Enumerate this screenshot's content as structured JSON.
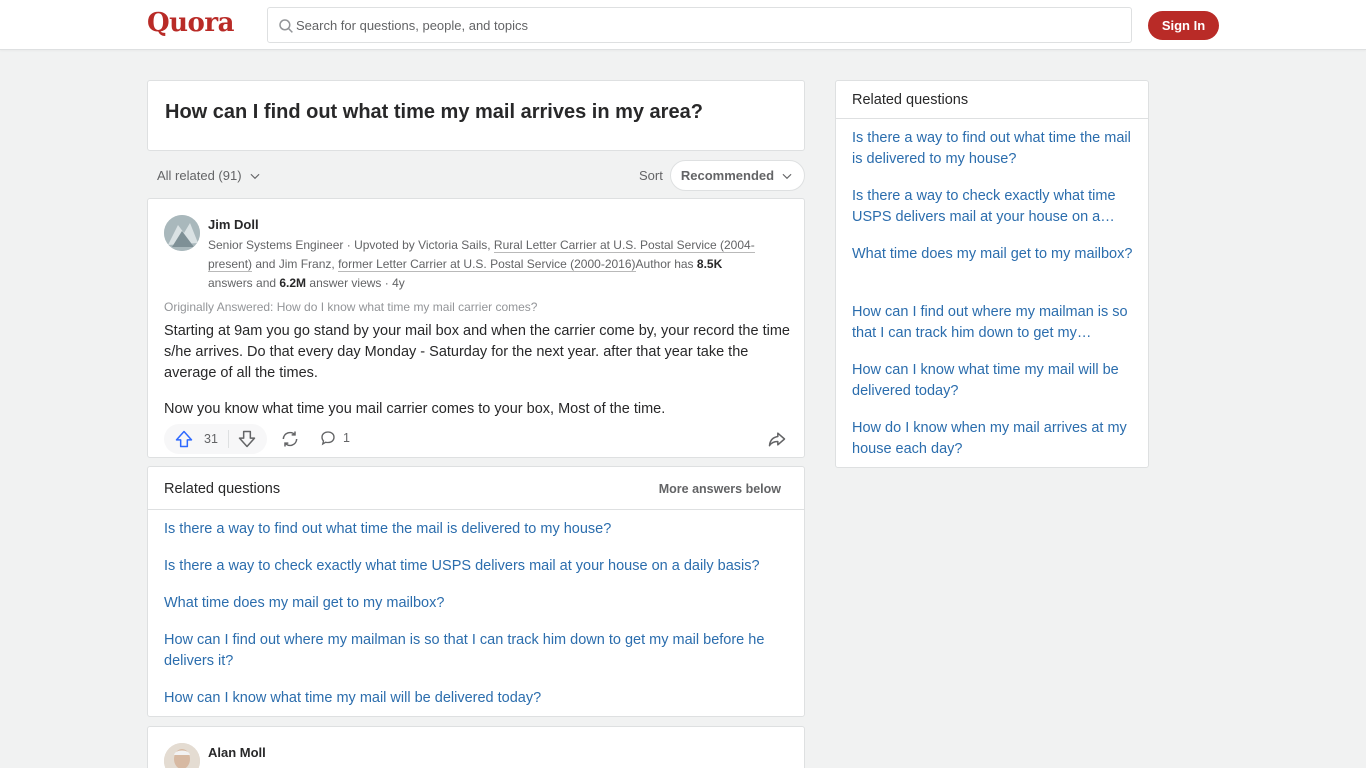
{
  "header": {
    "logo": "Quora",
    "search_placeholder": "Search for questions, people, and topics",
    "signin_label": "Sign In"
  },
  "question": {
    "title": "How can I find out what time my mail arrives in my area?"
  },
  "filters": {
    "all_related": "All related (91)",
    "sort_label": "Sort",
    "sort_value": "Recommended"
  },
  "answer": {
    "author": "Jim Doll",
    "cred_role": "Senior Systems Engineer · Upvoted by Victoria Sails, ",
    "cred_link1": "Rural Letter Carrier at U.S. Postal Service (2004-present)",
    "cred_and": " and Jim Franz, ",
    "cred_link2": "former Letter Carrier at U.S. Postal Service (2000-2016)",
    "cred_author_has": "Author has ",
    "cred_answers": "8.5K",
    "cred_answers_suffix": " answers and ",
    "cred_views": "6.2M",
    "cred_views_suffix": " answer views · 4y",
    "originally": "Originally Answered: How do I know what time my mail carrier comes?",
    "body_p1": "Starting at 9am you go stand by your mail box and when the carrier come by, your record the time s/he arrives. Do that every day Monday - Saturday for the next year. after that year take the average of all the times.",
    "body_p2": "Now you know what time you mail carrier comes to your box, Most of the time.",
    "upvotes": "31",
    "comments": "1"
  },
  "related_inline": {
    "title": "Related questions",
    "more": "More answers below",
    "items": [
      "Is there a way to find out what time the mail is delivered to my house?",
      "Is there a way to check exactly what time USPS delivers mail at your house on a daily basis?",
      "What time does my mail get to my mailbox?",
      "How can I find out where my mailman is so that I can track him down to get my mail before he delivers it?",
      "How can I know what time my mail will be delivered today?"
    ]
  },
  "answer2": {
    "author": "Alan Moll"
  },
  "sidebar": {
    "title": "Related questions",
    "items": [
      "Is there a way to find out what time the mail is delivered to my house?",
      "Is there a way to check exactly what time USPS delivers mail at your house on a…",
      "What time does my mail get to my mailbox?",
      "How can I find out where my mailman is so that I can track him down to get my…",
      "How can I know what time my mail will be delivered today?",
      "How do I know when my mail arrives at my house each day?"
    ]
  },
  "colors": {
    "brand": "#b92b27",
    "link": "#2b6dad",
    "upvote": "#2e69ff"
  }
}
